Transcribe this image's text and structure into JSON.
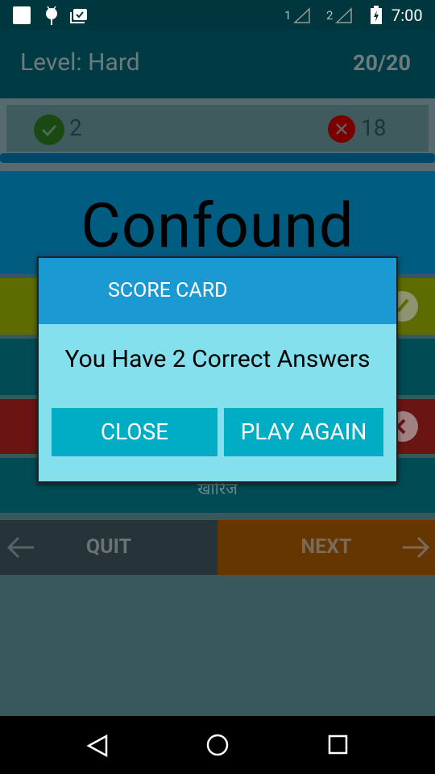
{
  "status_bar": {
    "time": "7:00",
    "sim1": "1",
    "sim2": "2"
  },
  "header": {
    "level": "Level: Hard",
    "progress": "20/20"
  },
  "score": {
    "correct": "2",
    "wrong": "18"
  },
  "question": {
    "word": "Confound"
  },
  "options": [
    {
      "label": "",
      "state": "correct"
    },
    {
      "label": ""
    },
    {
      "label": "",
      "state": "wrong"
    },
    {
      "label": "खारिज"
    }
  ],
  "footer": {
    "quit": "QUIT",
    "next": "NEXT"
  },
  "dialog": {
    "title": "SCORE CARD",
    "message": "You Have 2 Correct Answers",
    "close": "CLOSE",
    "play_again": "PLAY AGAIN"
  },
  "colors": {
    "dialog_header": "#1a99d2",
    "dialog_body": "#84e0ec",
    "dialog_button": "#00adc5"
  }
}
